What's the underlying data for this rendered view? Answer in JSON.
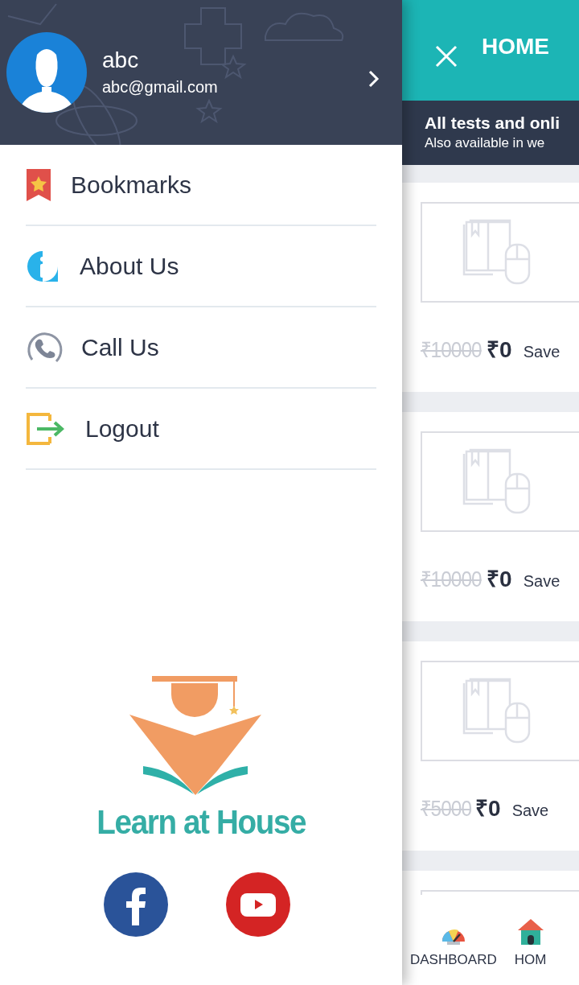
{
  "drawer": {
    "profile": {
      "name": "abc",
      "email": "abc@gmail.com"
    },
    "menu": [
      {
        "kind": "bookmark",
        "label": "Bookmarks"
      },
      {
        "kind": "info",
        "label": "About Us"
      },
      {
        "kind": "phone",
        "label": "Call Us"
      },
      {
        "kind": "logout",
        "label": "Logout"
      }
    ],
    "brand": {
      "name": "Learn at House"
    },
    "social": [
      {
        "kind": "facebook"
      },
      {
        "kind": "youtube"
      }
    ]
  },
  "app_header": {
    "title": "HOME"
  },
  "banner": {
    "title": "All tests and onli",
    "subtitle": "Also available in we"
  },
  "courses": [
    {
      "old_price": "₹10000",
      "price": "₹0",
      "save_label": "Save"
    },
    {
      "old_price": "₹10000",
      "price": "₹0",
      "save_label": "Save"
    },
    {
      "old_price": "₹5000",
      "price": "₹0",
      "save_label": "Save"
    }
  ],
  "bottom_nav": [
    {
      "kind": "dashboard",
      "label": "DASHBOARD"
    },
    {
      "kind": "home",
      "label": "HOM"
    }
  ]
}
